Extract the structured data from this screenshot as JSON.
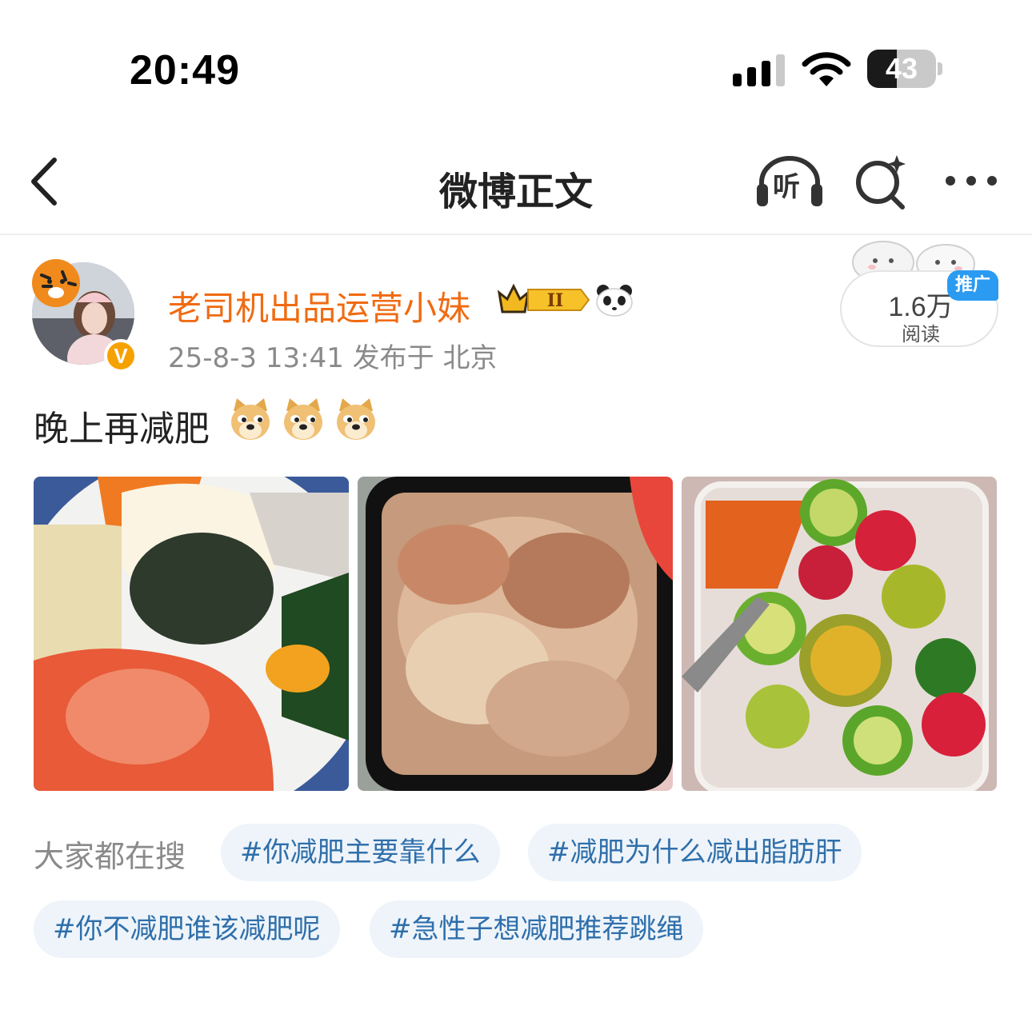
{
  "status_bar": {
    "time": "20:49",
    "battery_level": "43",
    "signal_bars": 4,
    "wifi": true
  },
  "nav": {
    "title": "微博正文",
    "listen_label": "听",
    "icons": [
      "back-icon",
      "listen-headphones-icon",
      "ai-search-icon",
      "more-icon"
    ]
  },
  "post": {
    "author": "老司机出品运营小妹",
    "author_color": "#f06b12",
    "verified_badge": "V",
    "member_level": "II",
    "meta": "25-8-3 13:41  发布于 北京",
    "read_count": "1.6万",
    "read_label": "阅读",
    "promo_tag": "推广",
    "text": "晚上再减肥",
    "emojis": [
      "doge",
      "doge",
      "doge"
    ],
    "photos": [
      "bibimbap-photo",
      "cold-noodle-photo",
      "lime-fruit-photo"
    ]
  },
  "trending": {
    "label": "大家都在搜",
    "chips": [
      "#你减肥主要靠什么",
      "#减肥为什么减出脂肪肝",
      "#你不减肥谁该减肥呢",
      "#急性子想减肥推荐跳绳"
    ],
    "chip_text_color": "#2f6fab"
  }
}
